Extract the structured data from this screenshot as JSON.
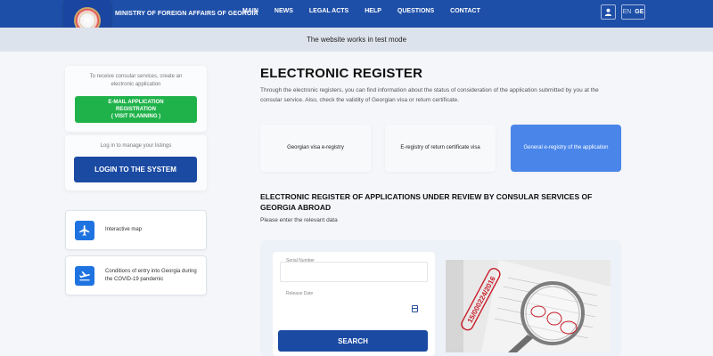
{
  "header": {
    "ministry_name": "MINISTRY OF FOREIGN AFFAIRS OF GEORGIA",
    "nav": [
      "MAIN",
      "NEWS",
      "LEGAL ACTS",
      "HELP",
      "QUESTIONS",
      "CONTACT"
    ],
    "lang_en": "EN",
    "lang_ge": "GE"
  },
  "banner": {
    "text": "The website works in test mode"
  },
  "sidebar": {
    "consular_note": "To receive consular services, create an electronic application",
    "email_button_line1": "E-MAIL APPLICATION",
    "email_button_line2": "REGISTRATION",
    "email_button_line3": "( VISIT PLANNING )",
    "login_note": "Log in to manage your listings",
    "login_button": "LOGIN TO THE SYSTEM",
    "links": [
      {
        "label": "Interactive map",
        "icon": "airplane-icon"
      },
      {
        "label": "Conditions of entry into Georgia during the COVID-19 pandemic",
        "icon": "plane-takeoff-icon"
      }
    ]
  },
  "main": {
    "title": "ELECTRONIC REGISTER",
    "description": "Through the electronic registers, you can find information about the status of consideration of the application submitted by you at the consular service. Also, check the validity of Georgian visa or return certificate.",
    "tabs": [
      {
        "label": "Georgian visa e-registry",
        "active": false
      },
      {
        "label": "E-registry of return certificate visa",
        "active": false
      },
      {
        "label": "General e-registry of the application",
        "active": true
      }
    ],
    "section_title": "ELECTRONIC REGISTER OF APPLICATIONS UNDER REVIEW BY CONSULAR SERVICES OF GEORGIA ABROAD",
    "section_subtitle": "Please enter the relevant data",
    "form": {
      "serial_label": "Serial Number",
      "serial_value": "",
      "date_label": "Release Date",
      "date_value": "",
      "search_button": "SEARCH"
    },
    "photo_stamp_text": "15/000224/2016"
  },
  "colors": {
    "header_blue": "#1e4fa8",
    "green": "#1fb24a",
    "active_tab": "#4a86ea",
    "banner": "#dde3ec"
  }
}
